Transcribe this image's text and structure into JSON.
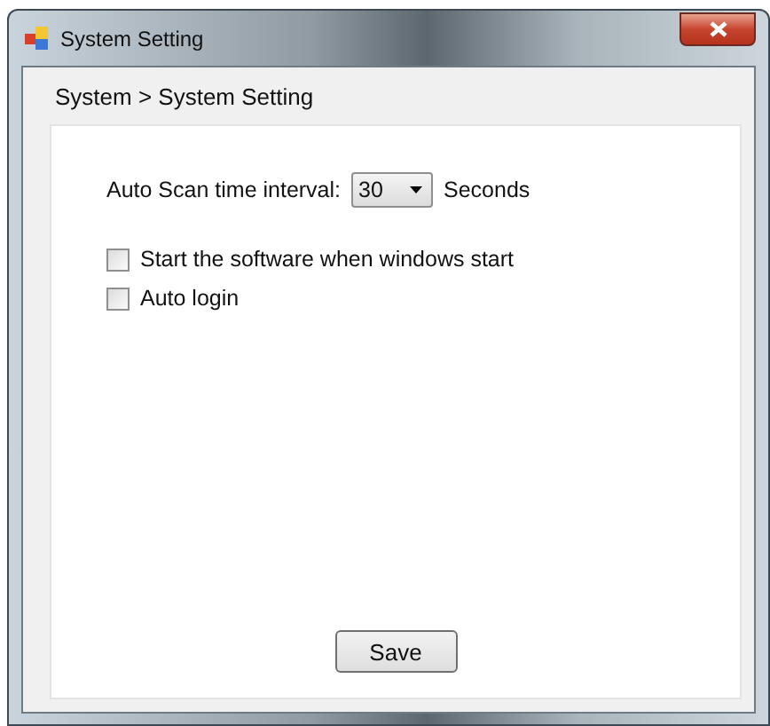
{
  "window": {
    "title": "System Setting"
  },
  "breadcrumb": "System > System Setting",
  "scan_interval": {
    "label": "Auto Scan time interval:",
    "value": "30",
    "unit": "Seconds"
  },
  "options": [
    {
      "label": "Start the software when windows start",
      "checked": false
    },
    {
      "label": "Auto login",
      "checked": false
    }
  ],
  "buttons": [
    "Save"
  ]
}
